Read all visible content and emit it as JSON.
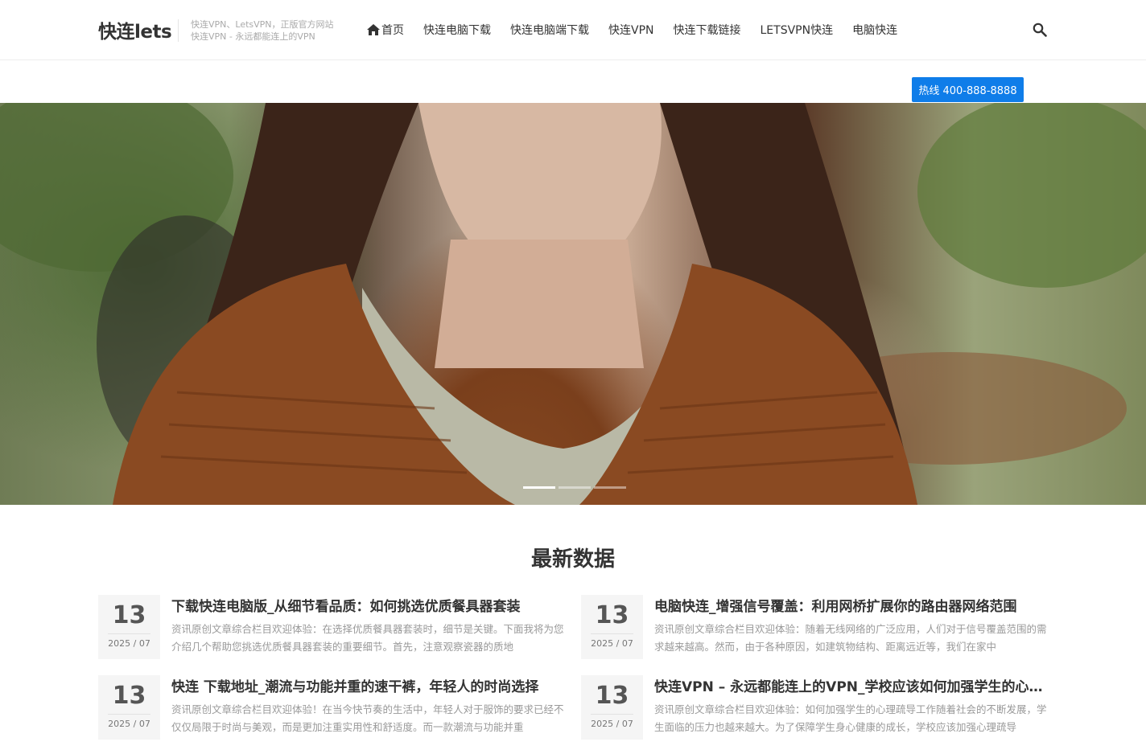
{
  "header": {
    "logo": "快连lets",
    "tagline_line1": "快连VPN、LetsVPN，正版官方网站",
    "tagline_line2": "快连VPN - 永远都能连上的VPN",
    "nav": [
      {
        "label": "首页",
        "icon": "home-icon"
      },
      {
        "label": "快连电脑下载"
      },
      {
        "label": "快连电脑端下载"
      },
      {
        "label": "快连VPN"
      },
      {
        "label": "快连下载链接"
      },
      {
        "label": "LETSVPN快连"
      },
      {
        "label": "电脑快连"
      }
    ],
    "search_icon": "search-icon"
  },
  "hotline": "热线 400-888-8888",
  "banner": {
    "slides": 3,
    "active_slide": 1
  },
  "section": {
    "title": "最新数据"
  },
  "posts": [
    {
      "day": "13",
      "ym": "2025 / 07",
      "title": "下载快连电脑版_从细节看品质：如何挑选优质餐具器套装",
      "excerpt": "资讯原创文章综合栏目欢迎体验：在选择优质餐具器套装时，细节是关键。下面我将为您介绍几个帮助您挑选优质餐具器套装的重要细节。首先，注意观察瓷器的质地"
    },
    {
      "day": "13",
      "ym": "2025 / 07",
      "title": "电脑快连_增强信号覆盖：利用网桥扩展你的路由器网络范围",
      "excerpt": "资讯原创文章综合栏目欢迎体验：随着无线网络的广泛应用，人们对于信号覆盖范围的需求越来越高。然而，由于各种原因，如建筑物结构、距离远近等，我们在家中"
    },
    {
      "day": "13",
      "ym": "2025 / 07",
      "title": "快连 下载地址_潮流与功能并重的速干裤，年轻人的时尚选择",
      "excerpt": "资讯原创文章综合栏目欢迎体验！在当今快节奏的生活中，年轻人对于服饰的要求已经不仅仅局限于时尚与美观，而是更加注重实用性和舒适度。而一款潮流与功能并重"
    },
    {
      "day": "13",
      "ym": "2025 / 07",
      "title": "快连VPN – 永远都能连上的VPN_学校应该如何加强学生的心理健康",
      "excerpt": "资讯原创文章综合栏目欢迎体验：如何加强学生的心理疏导工作随着社会的不断发展，学生面临的压力也越来越大。为了保障学生身心健康的成长，学校应该加强心理疏导"
    }
  ]
}
